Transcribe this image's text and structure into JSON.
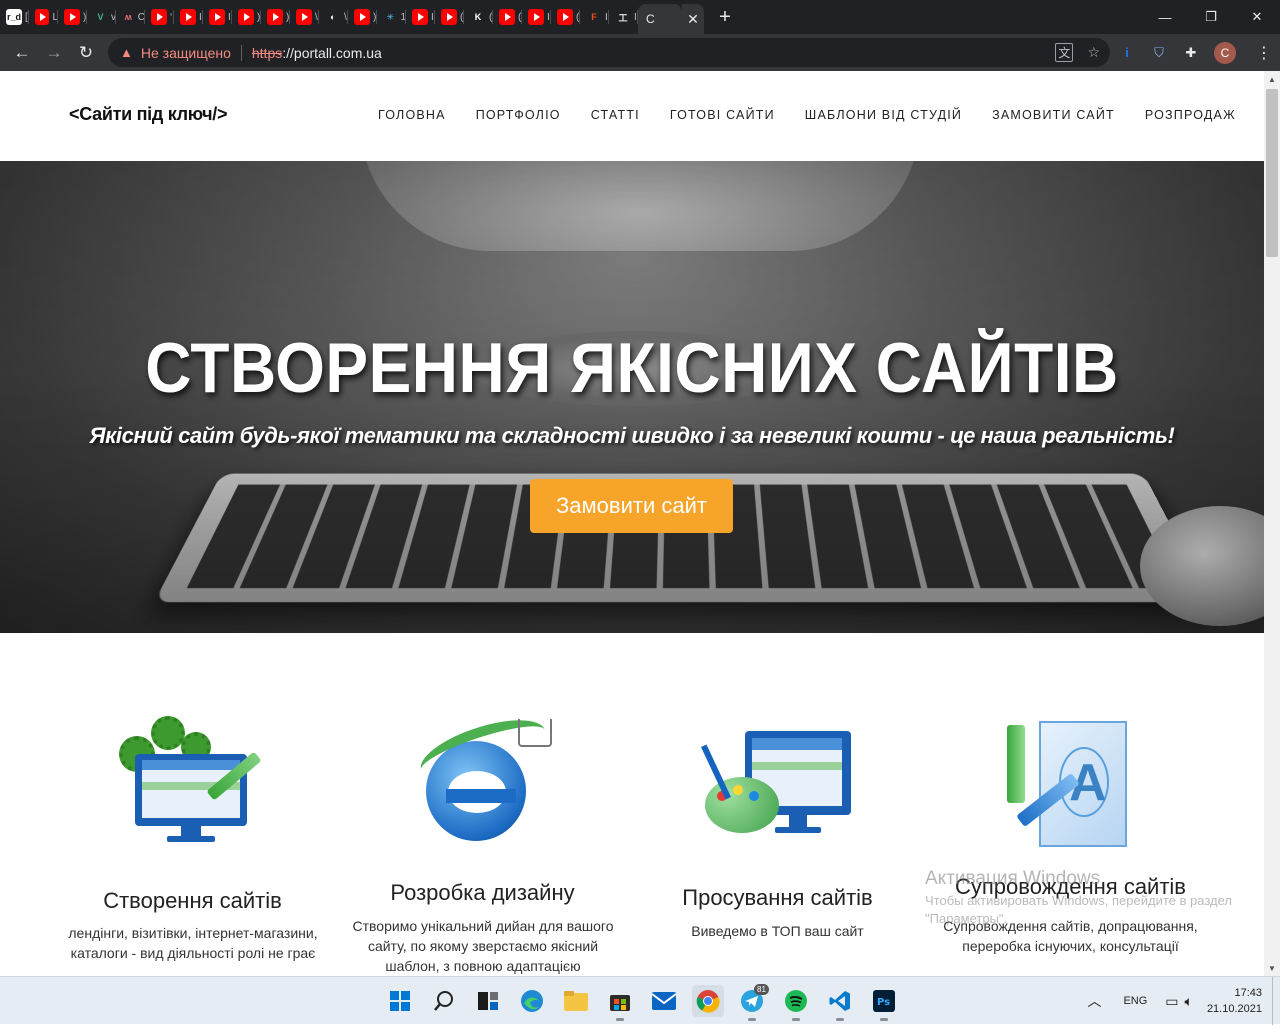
{
  "browser": {
    "tabs": [
      {
        "glyph": "r_d",
        "label": "[",
        "color": "#ffffff",
        "text": "#111111"
      },
      {
        "glyph": "",
        "label": "L",
        "type": "youtube"
      },
      {
        "glyph": "",
        "label": ")",
        "type": "youtube"
      },
      {
        "glyph": "V",
        "label": "v",
        "color": "#202124",
        "text": "#42b883"
      },
      {
        "glyph": "ʍ",
        "label": "C",
        "color": "#202124",
        "text": "#e06c75"
      },
      {
        "glyph": "",
        "label": "‘",
        "type": "youtube"
      },
      {
        "glyph": "",
        "label": "I",
        "type": "youtube"
      },
      {
        "glyph": "",
        "label": "I",
        "type": "youtube"
      },
      {
        "glyph": "",
        "label": ")",
        "type": "youtube"
      },
      {
        "glyph": "",
        "label": ")",
        "type": "youtube"
      },
      {
        "glyph": "",
        "label": "\\",
        "type": "youtube"
      },
      {
        "glyph": "◐",
        "label": "\\",
        "color": "#202124",
        "text": "#ffffff"
      },
      {
        "glyph": "",
        "label": ")",
        "type": "youtube"
      },
      {
        "glyph": "✳",
        "label": "1",
        "color": "#202124",
        "text": "#4fc3f7"
      },
      {
        "glyph": "",
        "label": "I",
        "type": "youtube"
      },
      {
        "glyph": "",
        "label": "(",
        "type": "youtube"
      },
      {
        "glyph": "K",
        "label": "(",
        "color": "#202124",
        "text": "#ffffff"
      },
      {
        "glyph": "",
        "label": "(",
        "type": "youtube"
      },
      {
        "glyph": "",
        "label": "I",
        "type": "youtube"
      },
      {
        "glyph": "",
        "label": "(",
        "type": "youtube"
      },
      {
        "glyph": "F",
        "label": "I",
        "color": "#202124",
        "text": "#f24e1e"
      },
      {
        "glyph": "工",
        "label": "I",
        "color": "#202124",
        "text": "#e8eaed"
      }
    ],
    "active_tab": {
      "label": "C"
    },
    "url_warning": "Не защищено",
    "url_scheme": "https",
    "url_rest": "://portall.com.ua",
    "profile_initial": "C",
    "colors": {
      "chrome_bg": "#202124",
      "toolbar_bg": "#35363a",
      "warning": "#f28b82"
    }
  },
  "site": {
    "logo": "<Сайти під ключ/>",
    "nav": [
      "Головна",
      "Портфоліо",
      "Статті",
      "Готові сайти",
      "Шаблони від студій",
      "Замовити сайт",
      "Розпродаж"
    ],
    "hero": {
      "title": "СТВОРЕННЯ ЯКІСНИХ САЙТІВ",
      "subtitle": "Якісний сайт будь-якої тематики та складності швидко і за невеликі кошти - це наша реальність!",
      "cta": "Замовити сайт",
      "cta_color": "#f7a42a"
    },
    "services": [
      {
        "title": "Створення сайтів",
        "desc": "лендінги, візитівки, інтернет-магазини, каталоги - вид діяльності ролі не грає",
        "icon": "monitor-gears-icon"
      },
      {
        "title": "Розробка дизайну",
        "desc": "Створимо унікальний дийан для вашого сайту, по якому зверстаємо якісний шаблон, з повною адаптацією",
        "icon": "browser-cart-icon"
      },
      {
        "title": "Просування сайтів",
        "desc": "Виведемо в ТОП ваш сайт",
        "icon": "palette-monitor-icon"
      },
      {
        "title": "Супровождення сайтів",
        "desc": "Супровождення сайтів, допрацювання, переробка існуючих, консультації",
        "icon": "pencil-drafting-icon"
      }
    ]
  },
  "overlay": {
    "watermark_title": "Активация Windows",
    "watermark_text": "Чтобы активировать Windows, перейдите в раздел \"Параметры\"."
  },
  "taskbar": {
    "icons": [
      "windows-start-icon",
      "search-icon",
      "task-view-icon",
      "edge-icon",
      "file-explorer-icon",
      "store-icon",
      "mail-icon",
      "chrome-icon",
      "telegram-icon",
      "spotify-icon",
      "vscode-icon",
      "photoshop-icon"
    ],
    "telegram_badge": "81",
    "lang": "ENG",
    "time": "17:43",
    "date": "21.10.2021"
  }
}
